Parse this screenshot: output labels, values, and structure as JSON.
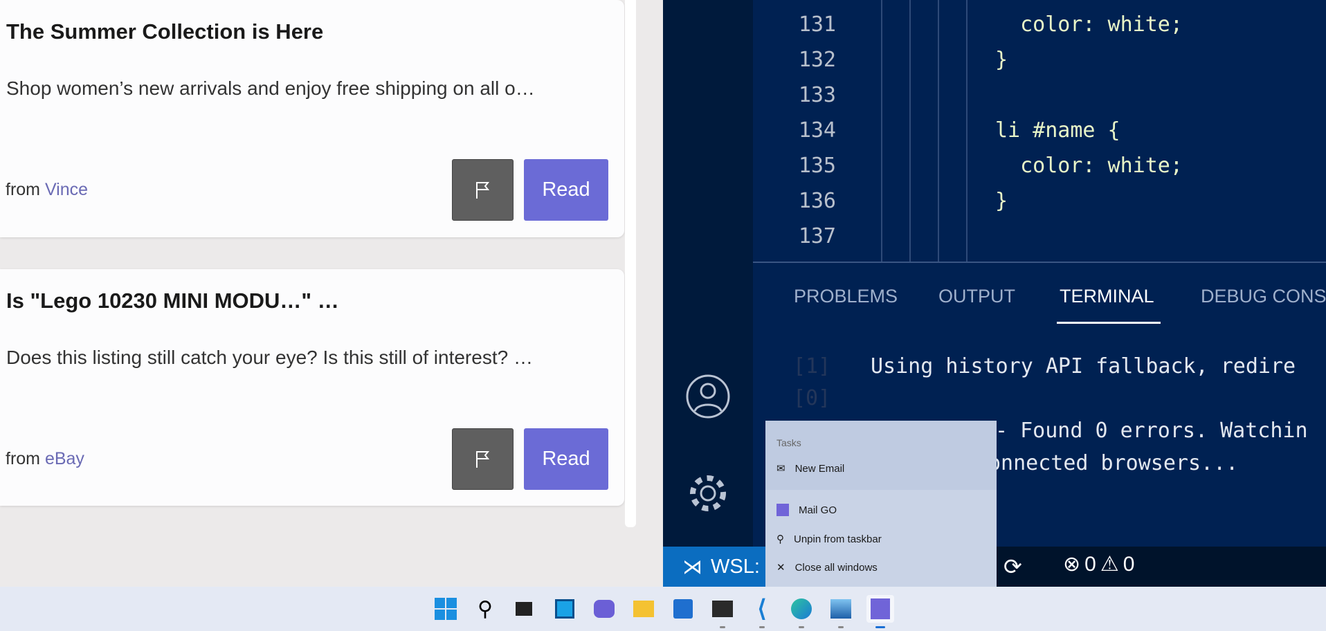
{
  "cards": [
    {
      "title": "The Summer Collection is Here",
      "body": "Shop women’s new arrivals and enjoy free shipping on all o…",
      "from_label": "from",
      "sender": "Vince",
      "read_label": "Read"
    },
    {
      "title": "Is \"Lego 10230 MINI MODU…\" …",
      "body": "Does this listing still catch your eye? Is this still of interest? …",
      "from_label": "from",
      "sender": "eBay",
      "read_label": "Read"
    }
  ],
  "editor": {
    "lines": [
      {
        "num": "131",
        "code": "  color: white;"
      },
      {
        "num": "132",
        "code": "}"
      },
      {
        "num": "133",
        "code": ""
      },
      {
        "num": "134",
        "code": "li #name {"
      },
      {
        "num": "135",
        "code": "  color: white;"
      },
      {
        "num": "136",
        "code": "}"
      },
      {
        "num": "137",
        "code": ""
      }
    ]
  },
  "panel": {
    "tabs": [
      "PROBLEMS",
      "OUTPUT",
      "TERMINAL",
      "DEBUG CONSO"
    ],
    "active_tab": "TERMINAL",
    "terminal": {
      "prefix1": "[1]",
      "line1": "Using history API fallback, redire",
      "prefix2": "[0]",
      "line3": "- Found 0 errors. Watchin",
      "line4": "onnected browsers..."
    }
  },
  "status": {
    "remote": "WSL:",
    "errors": "0",
    "warnings": "0"
  },
  "jumplist": {
    "header": "Tasks",
    "items": [
      "New Email",
      "Mail GO",
      "Unpin from taskbar",
      "Close all windows"
    ]
  },
  "taskbar": {
    "apps": [
      "start",
      "search",
      "task-view",
      "widgets",
      "chat",
      "file-explorer",
      "store",
      "terminal",
      "vscode",
      "edge",
      "photos",
      "mail-go"
    ]
  }
}
